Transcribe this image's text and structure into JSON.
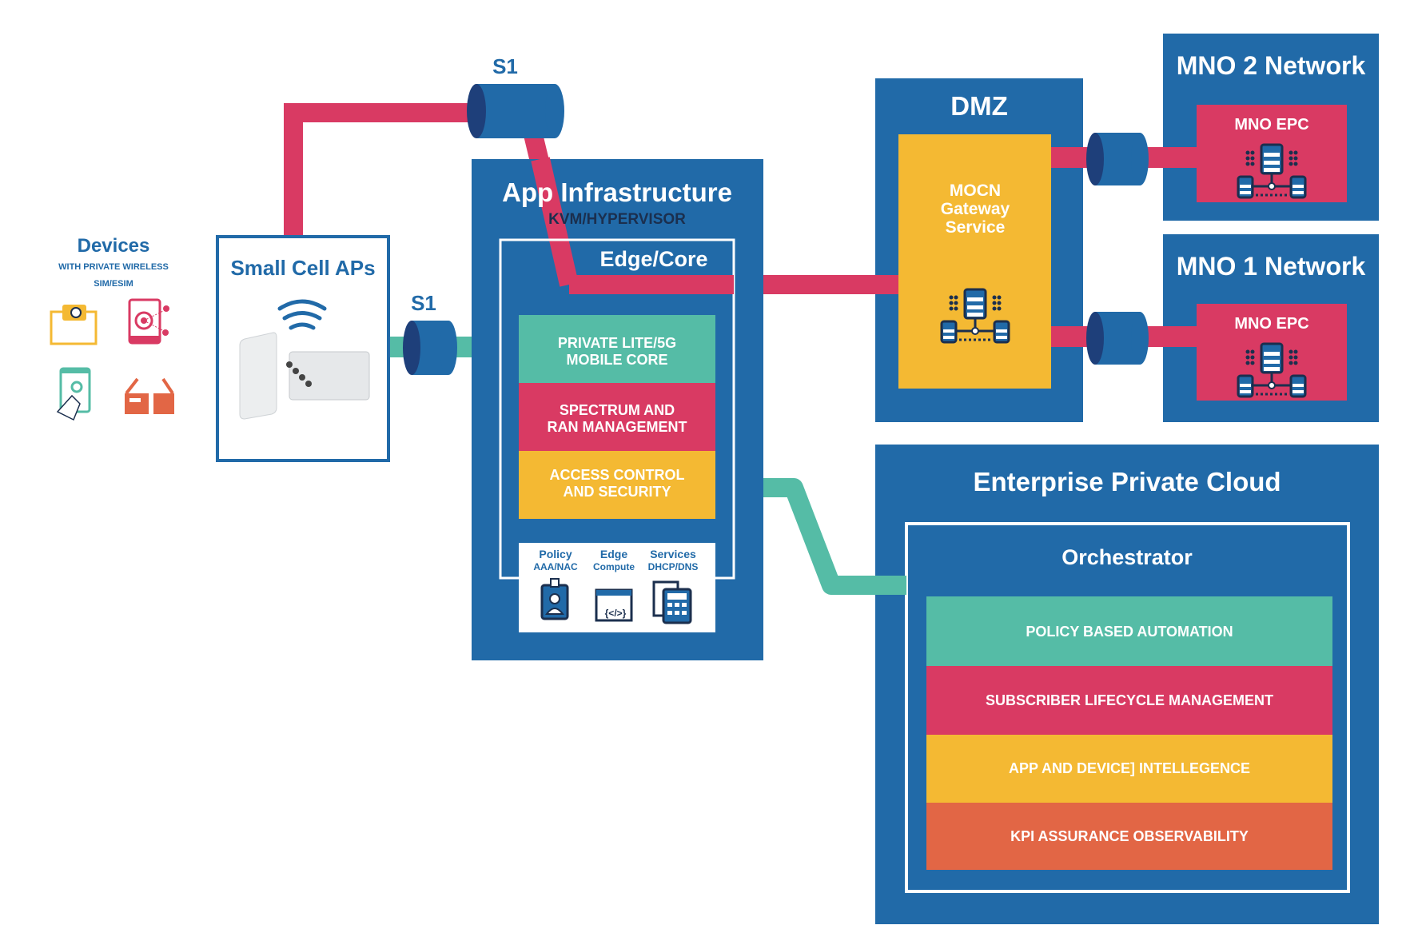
{
  "colors": {
    "blue": "#216aa8",
    "red": "#d93a63",
    "yellow": "#f4b933",
    "teal": "#55bca6",
    "orange": "#e26645",
    "navy": "#1b2f4e"
  },
  "devices": {
    "title": "Devices",
    "subtitle_line1": "WITH PRIVATE WIRELESS",
    "subtitle_line2": "SIM/ESIM",
    "icons": [
      "vr-headset-icon",
      "phone-target-icon",
      "touch-tablet-icon",
      "smart-glasses-icon"
    ]
  },
  "small_cell": {
    "title": "Small Cell APs",
    "icons": [
      "wifi-icon",
      "access-point-device-icon"
    ]
  },
  "links": {
    "s1_top": "S1",
    "s1_mid": "S1"
  },
  "app_infra": {
    "title": "App Infrastructure",
    "subtitle": "KVM/HYPERVISOR",
    "edge_title": "Edge/Core",
    "layers": [
      {
        "line1": "PRIVATE LITE/5G",
        "line2": "MOBILE CORE"
      },
      {
        "line1": "SPECTRUM AND",
        "line2": "RAN MANAGEMENT"
      },
      {
        "line1": "ACCESS CONTROL",
        "line2": "AND SECURITY"
      }
    ],
    "services": [
      {
        "title": "Policy",
        "sub": "AAA/NAC",
        "icon": "id-badge-icon"
      },
      {
        "title": "Edge",
        "sub": "Compute",
        "icon": "code-window-icon"
      },
      {
        "title": "Services",
        "sub": "DHCP/DNS",
        "icon": "calculator-icon"
      }
    ]
  },
  "dmz": {
    "title": "DMZ",
    "gateway_line1": "MOCN",
    "gateway_line2": "Gateway",
    "gateway_line3": "Service"
  },
  "mno2": {
    "title": "MNO 2 Network",
    "epc": "MNO EPC"
  },
  "mno1": {
    "title": "MNO 1 Network",
    "epc": "MNO EPC"
  },
  "enterprise": {
    "title": "Enterprise Private Cloud",
    "orchestrator": "Orchestrator",
    "layers": [
      "POLICY BASED AUTOMATION",
      "SUBSCRIBER LIFECYCLE MANAGEMENT",
      "APP AND DEVICE] INTELLEGENCE",
      "KPI ASSURANCE OBSERVABILITY"
    ]
  }
}
